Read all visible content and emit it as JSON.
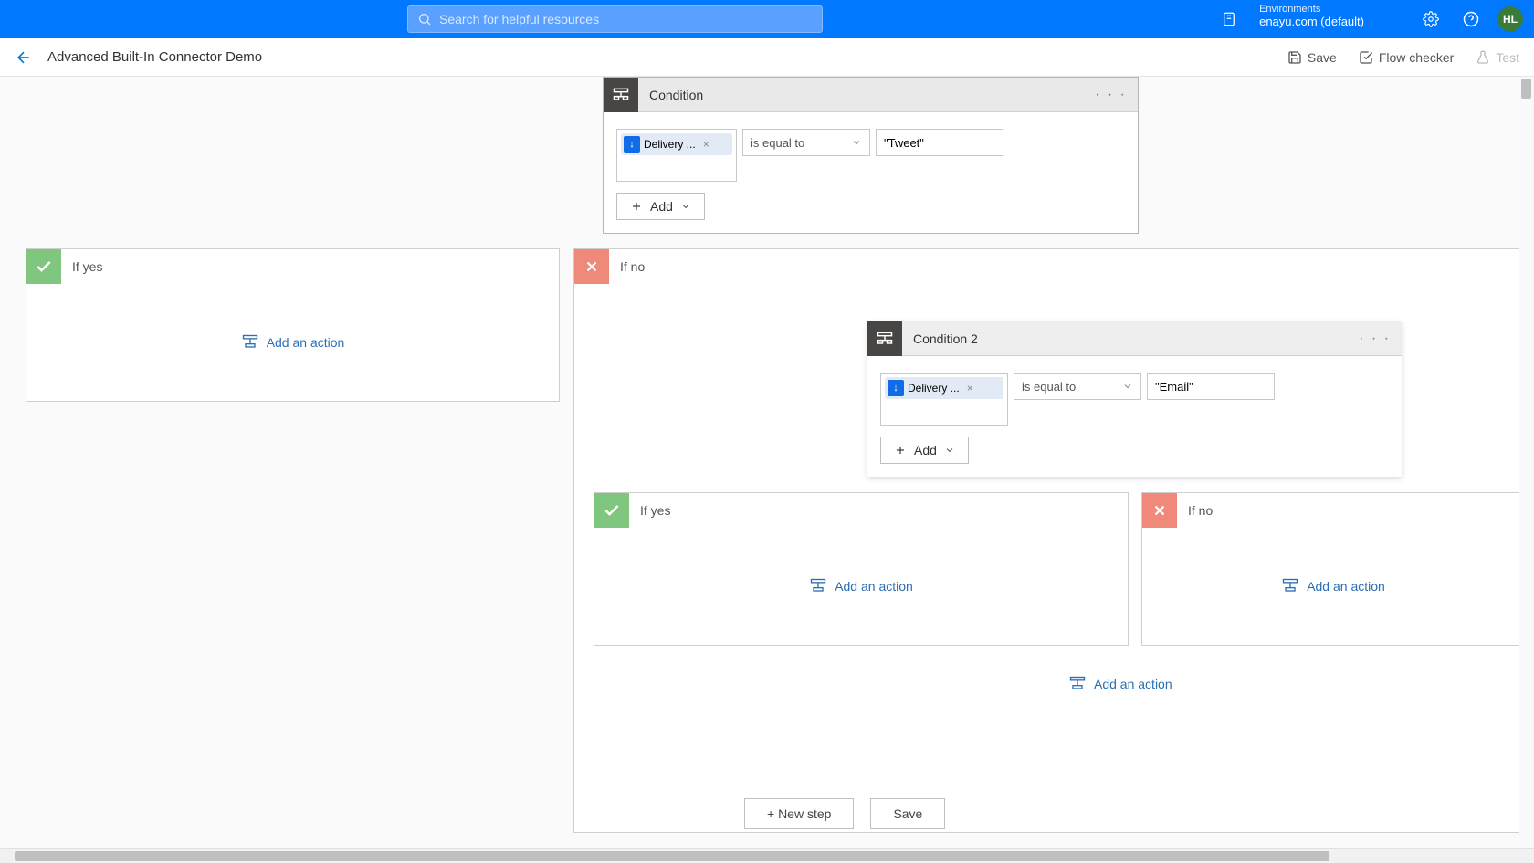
{
  "topbar": {
    "search_placeholder": "Search for helpful resources",
    "env_label": "Environments",
    "env_value": "enayu.com (default)",
    "avatar_initials": "HL"
  },
  "subheader": {
    "flow_title": "Advanced Built-In Connector Demo",
    "save": "Save",
    "flow_checker": "Flow checker",
    "test": "Test"
  },
  "cond1": {
    "title": "Condition",
    "token_label": "Delivery ...",
    "operator": "is equal to",
    "value": "\"Tweet\"",
    "add": "Add"
  },
  "cond2": {
    "title": "Condition 2",
    "token_label": "Delivery ...",
    "operator": "is equal to",
    "value": "\"Email\"",
    "add": "Add"
  },
  "branches": {
    "yes": "If yes",
    "no": "If no",
    "add_action": "Add an action"
  },
  "bottom": {
    "new_step": "+ New step",
    "save": "Save"
  }
}
